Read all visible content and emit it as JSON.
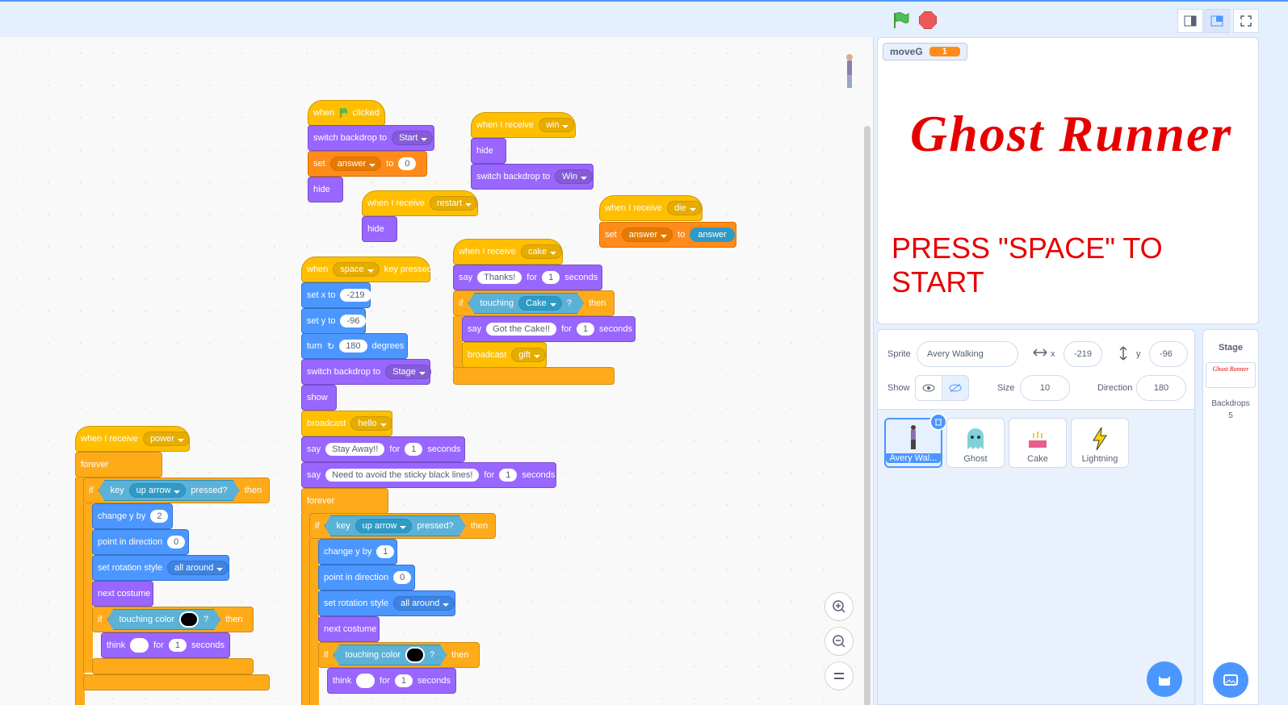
{
  "toolbar": {
    "flag_icon": "green-flag",
    "stop_icon": "stop-sign"
  },
  "script1": {
    "hat_when": "when",
    "hat_clicked": "clicked",
    "switch_label": "switch backdrop to",
    "switch_val": "Start",
    "set_label": "set",
    "set_var": "answer",
    "set_to": "to",
    "set_val": "0",
    "hide": "hide"
  },
  "script2": {
    "when_receive": "when I receive",
    "msg": "win",
    "hide": "hide",
    "switch_label": "switch backdrop to",
    "switch_val": "Win"
  },
  "script3": {
    "when_receive": "when I receive",
    "msg": "restart",
    "hide": "hide"
  },
  "script4": {
    "when_receive": "when I receive",
    "msg": "die",
    "set": "set",
    "var": "answer",
    "to": "to",
    "val": "answer"
  },
  "script5": {
    "when_receive": "when I receive",
    "msg": "cake",
    "say": "say",
    "say_text": "Thanks!",
    "for": "for",
    "secs": "1",
    "seconds": "seconds",
    "if": "if",
    "touching": "touching",
    "touch_obj": "Cake",
    "q": "?",
    "then": "then",
    "say2_text": "Got the Cake!!",
    "broadcast": "broadcast",
    "bcast_msg": "gift"
  },
  "script6": {
    "when": "when",
    "key": "space",
    "key_pressed": "key pressed",
    "setx": "set x to",
    "xval": "-219",
    "sety": "set y to",
    "yval": "-96",
    "turn": "turn",
    "deg": "180",
    "degrees": "degrees",
    "switch_label": "switch backdrop to",
    "switch_val": "Stage",
    "show": "show",
    "broadcast": "broadcast",
    "bmsg": "hello",
    "say": "say",
    "say1": "Stay Away!!",
    "for": "for",
    "one": "1",
    "seconds": "seconds",
    "say2": "Need to avoid the sticky black lines!",
    "forever": "forever",
    "if": "if",
    "key_lbl": "key",
    "key_val": "up arrow",
    "pressed": "pressed?",
    "then": "then",
    "changey": "change y by",
    "cy": "1",
    "point": "point in direction",
    "pdir": "0",
    "rot": "set rotation style",
    "rotv": "all around",
    "next": "next costume",
    "touchcol": "touching color",
    "q": "?",
    "think": "think"
  },
  "script7": {
    "when_receive": "when I receive",
    "msg": "power",
    "forever": "forever",
    "if": "if",
    "key_lbl": "key",
    "key_val": "up arrow",
    "pressed": "pressed?",
    "then": "then",
    "changey": "change y by",
    "cy": "2",
    "point": "point in direction",
    "pdir": "0",
    "rot": "set rotation style",
    "rotv": "all around",
    "next": "next costume",
    "touchcol": "touching color",
    "q": "?",
    "think": "think",
    "for": "for",
    "one": "1",
    "seconds": "seconds"
  },
  "stage": {
    "monitor_name": "moveG",
    "monitor_val": "1",
    "title": "Ghost Runner",
    "press": "PRESS  \"SPACE\" TO START"
  },
  "sprite_info": {
    "sprite_label": "Sprite",
    "sprite_name": "Avery Walking",
    "x_label": "x",
    "x": "-219",
    "y_label": "y",
    "y": "-96",
    "show_label": "Show",
    "size_label": "Size",
    "size": "10",
    "dir_label": "Direction",
    "dir": "180"
  },
  "sprites": [
    {
      "name": "Avery Wal..."
    },
    {
      "name": "Ghost"
    },
    {
      "name": "Cake"
    },
    {
      "name": "Lightning"
    }
  ],
  "stage_pane": {
    "title": "Stage",
    "thumb": "Ghost Runner",
    "backdrops_label": "Backdrops",
    "backdrops": "5"
  }
}
